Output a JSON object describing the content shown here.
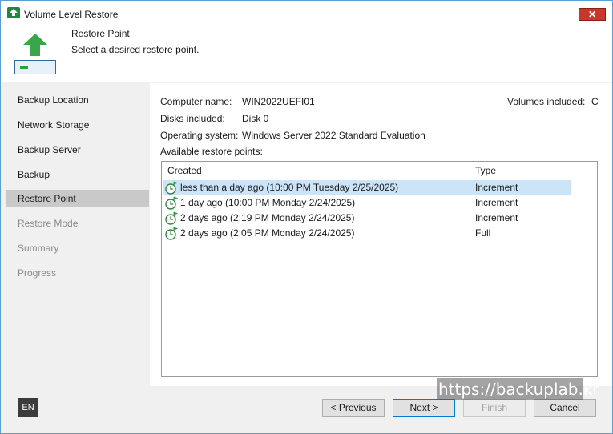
{
  "window": {
    "title": "Volume Level Restore",
    "close_label": "✕"
  },
  "header": {
    "title": "Restore Point",
    "subtitle": "Select a desired restore point."
  },
  "sidebar": {
    "items": [
      {
        "label": "Backup Location",
        "state": "normal"
      },
      {
        "label": "Network Storage",
        "state": "normal"
      },
      {
        "label": "Backup Server",
        "state": "normal"
      },
      {
        "label": "Backup",
        "state": "normal"
      },
      {
        "label": "Restore Point",
        "state": "active"
      },
      {
        "label": "Restore Mode",
        "state": "disabled"
      },
      {
        "label": "Summary",
        "state": "disabled"
      },
      {
        "label": "Progress",
        "state": "disabled"
      }
    ]
  },
  "info": {
    "computer_name_label": "Computer name:",
    "computer_name": "WIN2022UEFI01",
    "disks_label": "Disks included:",
    "disks": "Disk 0",
    "os_label": "Operating system:",
    "os": "Windows Server 2022 Standard Evaluation",
    "volumes_label": "Volumes included:",
    "volumes": "C",
    "restore_points_label": "Available restore points:"
  },
  "table": {
    "columns": [
      "Created",
      "Type"
    ],
    "rows": [
      {
        "created": "less than a day ago (10:00 PM Tuesday 2/25/2025)",
        "type": "Increment",
        "selected": true
      },
      {
        "created": "1 day ago (10:00 PM Monday 2/24/2025)",
        "type": "Increment",
        "selected": false
      },
      {
        "created": "2 days ago (2:19 PM Monday 2/24/2025)",
        "type": "Increment",
        "selected": false
      },
      {
        "created": "2 days ago (2:05 PM Monday 2/24/2025)",
        "type": "Full",
        "selected": false
      }
    ]
  },
  "footer": {
    "language": "EN",
    "previous_label": "< Previous",
    "next_label": "Next >",
    "finish_label": "Finish",
    "cancel_label": "Cancel"
  },
  "watermark": "https://backuplab.kr",
  "colors": {
    "accent": "#0078d7",
    "selection": "#cce4f7",
    "brand_green": "#2ea043",
    "close_red": "#c8372b"
  }
}
